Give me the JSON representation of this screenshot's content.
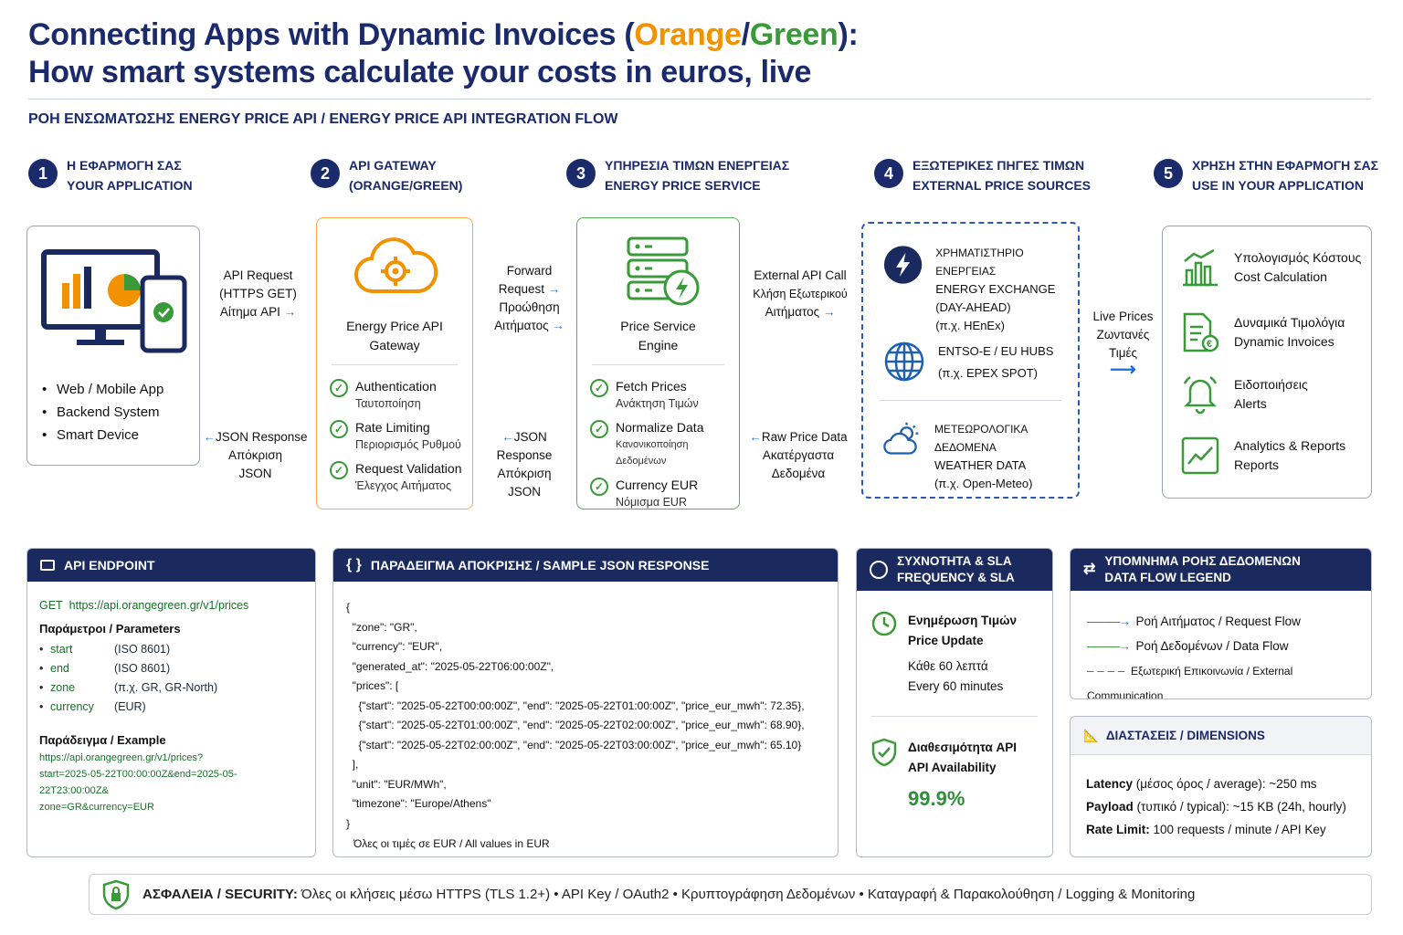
{
  "header": {
    "title_line1_a": "Connecting Apps with Dynamic Invoices (",
    "title_orange": "Orange",
    "title_slash": "/",
    "title_green": "Green",
    "title_line1_b": "):",
    "title_line2": "How smart systems calculate your costs in euros, live",
    "subtitle": "ΡΟΗ ΕΝΣΩΜΑΤΩΣΗΣ ENERGY PRICE API / ENERGY PRICE API INTEGRATION FLOW"
  },
  "steps": [
    {
      "num": "1",
      "line1": "Η ΕΦΑΡΜΟΓΗ ΣΑΣ",
      "line2": "YOUR APPLICATION"
    },
    {
      "num": "2",
      "line1": "API GATEWAY",
      "line2": "(ORANGE/GREEN)"
    },
    {
      "num": "3",
      "line1": "ΥΠΗΡΕΣΙΑ ΤΙΜΩΝ ΕΝΕΡΓΕΙΑΣ",
      "line2": "ENERGY PRICE SERVICE"
    },
    {
      "num": "4",
      "line1": "ΕΞΩΤΕΡΙΚΕΣ ΠΗΓΕΣ ΤΙΜΩΝ",
      "line2": "EXTERNAL PRICE SOURCES"
    },
    {
      "num": "5",
      "line1": "ΧΡΗΣΗ ΣΤΗΝ ΕΦΑΡΜΟΓΗ ΣΑΣ",
      "line2": "USE IN YOUR APPLICATION"
    }
  ],
  "app": {
    "items": [
      "Web / Mobile App",
      "Backend System",
      "Smart Device"
    ]
  },
  "connectors": {
    "c1_top": [
      "API Request",
      "(HTTPS GET)",
      "Αίτημα API"
    ],
    "c1_bottom": [
      "JSON Response",
      "Απόκριση",
      "JSON"
    ],
    "c2_top": [
      "Forward",
      "Request",
      "Προώθηση",
      "Αιτήματος"
    ],
    "c2_bottom": [
      "JSON Response",
      "Απόκριση",
      "JSON"
    ],
    "c3_top": [
      "External API Call",
      "Κλήση Εξωτερικού",
      "Αιτήματος"
    ],
    "c3_bottom": [
      "Raw Price Data",
      "Ακατέργαστα",
      "Δεδομένα"
    ],
    "c4": [
      "Live Prices",
      "Ζωντανές",
      "Τιμές"
    ]
  },
  "gateway": {
    "title1": "Energy Price API",
    "title2": "Gateway",
    "features": [
      {
        "en": "Authentication",
        "gr": "Ταυτοποίηση"
      },
      {
        "en": "Rate Limiting",
        "gr": "Περιορισμός Ρυθμού"
      },
      {
        "en": "Request Validation",
        "gr": "Έλεγχος Αιτήματος"
      }
    ]
  },
  "service": {
    "title1": "Price Service",
    "title2": "Engine",
    "features": [
      {
        "en": "Fetch Prices",
        "gr": "Ανάκτηση Τιμών"
      },
      {
        "en": "Normalize Data",
        "gr": "Κανονικοποίηση Δεδομένων"
      },
      {
        "en": "Currency EUR",
        "gr": "Νόμισμα EUR"
      }
    ]
  },
  "sources": [
    {
      "l1": "ΧΡΗΜΑΤΙΣΤΗΡΙΟ ΕΝΕΡΓΕΙΑΣ",
      "l2": "ENERGY EXCHANGE",
      "l3": "(DAY-AHEAD)",
      "l4": "(π.χ. HEnEx)"
    },
    {
      "l1": "ENTSO-E / EU HUBS",
      "l2": "(π.χ. EPEX SPOT)"
    },
    {
      "l1": "ΜΕΤΕΩΡΟΛΟΓΙΚΑ ΔΕΔΟΜΕΝΑ",
      "l2": "WEATHER DATA",
      "l3": "(π.χ. Open-Meteo)"
    }
  ],
  "uses": [
    {
      "gr": "Υπολογισμός Κόστους",
      "en": "Cost Calculation"
    },
    {
      "gr": "Δυναμικά Τιμολόγια",
      "en": "Dynamic Invoices"
    },
    {
      "gr": "Ειδοποιήσεις",
      "en": "Alerts"
    },
    {
      "gr": "Analytics & Reports",
      "en": "Reports"
    }
  ],
  "endpoint": {
    "head": "API ENDPOINT",
    "method": "GET",
    "url": "https://api.orangegreen.gr/v1/prices",
    "params_title": "Παράμετροι / Parameters",
    "params": [
      {
        "k": "start",
        "v": "(ISO 8601)"
      },
      {
        "k": "end",
        "v": "(ISO 8601)"
      },
      {
        "k": "zone",
        "v": "(π.χ. GR, GR-North)"
      },
      {
        "k": "currency",
        "v": "(EUR)"
      }
    ],
    "example_title": "Παράδειγμα / Example",
    "example_lines": [
      "https://api.orangegreen.gr/v1/prices?",
      "start=2025-05-22T00:00:00Z&end=2025-05-22T23:00:00Z&",
      "zone=GR&currency=EUR"
    ]
  },
  "json_panel": {
    "head": "ΠΑΡΑΔΕΙΓΜΑ ΑΠΟΚΡΙΣΗΣ / SAMPLE JSON RESPONSE",
    "lines": [
      "{",
      "  \"zone\": \"GR\",",
      "  \"currency\": \"EUR\",",
      "  \"generated_at\": \"2025-05-22T06:00:00Z\",",
      "  \"prices\": [",
      "    {\"start\": \"2025-05-22T00:00:00Z\", \"end\": \"2025-05-22T01:00:00Z\", \"price_eur_mwh\": 72.35},",
      "    {\"start\": \"2025-05-22T01:00:00Z\", \"end\": \"2025-05-22T02:00:00Z\", \"price_eur_mwh\": 68.90},",
      "    {\"start\": \"2025-05-22T02:00:00Z\", \"end\": \"2025-05-22T03:00:00Z\", \"price_eur_mwh\": 65.10}",
      "  ],",
      "  \"unit\": \"EUR/MWh\",",
      "  \"timezone\": \"Europe/Athens\"",
      "}"
    ],
    "footer": "Όλες οι τιμές σε EUR / All values in EUR"
  },
  "sla": {
    "head1": "ΣΥΧΝΟΤΗΤΑ & SLA",
    "head2": "FREQUENCY & SLA",
    "update_gr": "Ενημέρωση Τιμών",
    "update_en": "Price Update",
    "every_gr": "Κάθε 60 λεπτά",
    "every_en": "Every 60 minutes",
    "avail_gr": "Διαθεσιμότητα API",
    "avail_en": "API Availability",
    "avail_value": "99.9%"
  },
  "legend": {
    "head1": "ΥΠΟΜΝΗΜΑ ΡΟΗΣ ΔΕΔΟΜΕΝΩΝ",
    "head2": "DATA FLOW LEGEND",
    "items": [
      "Ροή Αιτήματος / Request Flow",
      "Ροή Δεδομένων / Data Flow",
      "Εξωτερική Επικοινωνία / External Communication"
    ]
  },
  "dimensions": {
    "head": "ΔΙΑΣΤΑΣΕΙΣ / DIMENSIONS",
    "rows": [
      {
        "k": "Latency",
        "v": " (μέσος όρος / average): ~250 ms"
      },
      {
        "k": "Payload",
        "v": " (τυπικό / typical): ~15 KB (24h, hourly)"
      },
      {
        "k": "Rate Limit:",
        "v": " 100 requests / minute / API Key"
      }
    ]
  },
  "security": {
    "label": "ΑΣΦΑΛΕΙΑ / SECURITY:",
    "text": " Όλες οι κλήσεις μέσω HTTPS (TLS 1.2+) • API Key / OAuth2 • Κρυπτογράφηση Δεδομένων • Καταγραφή & Παρακολούθηση / Logging & Monitoring"
  },
  "colors": {
    "navy": "#1b2a6b",
    "orange": "#f39200",
    "green": "#3a9a3a",
    "blue": "#1f6fd0"
  }
}
